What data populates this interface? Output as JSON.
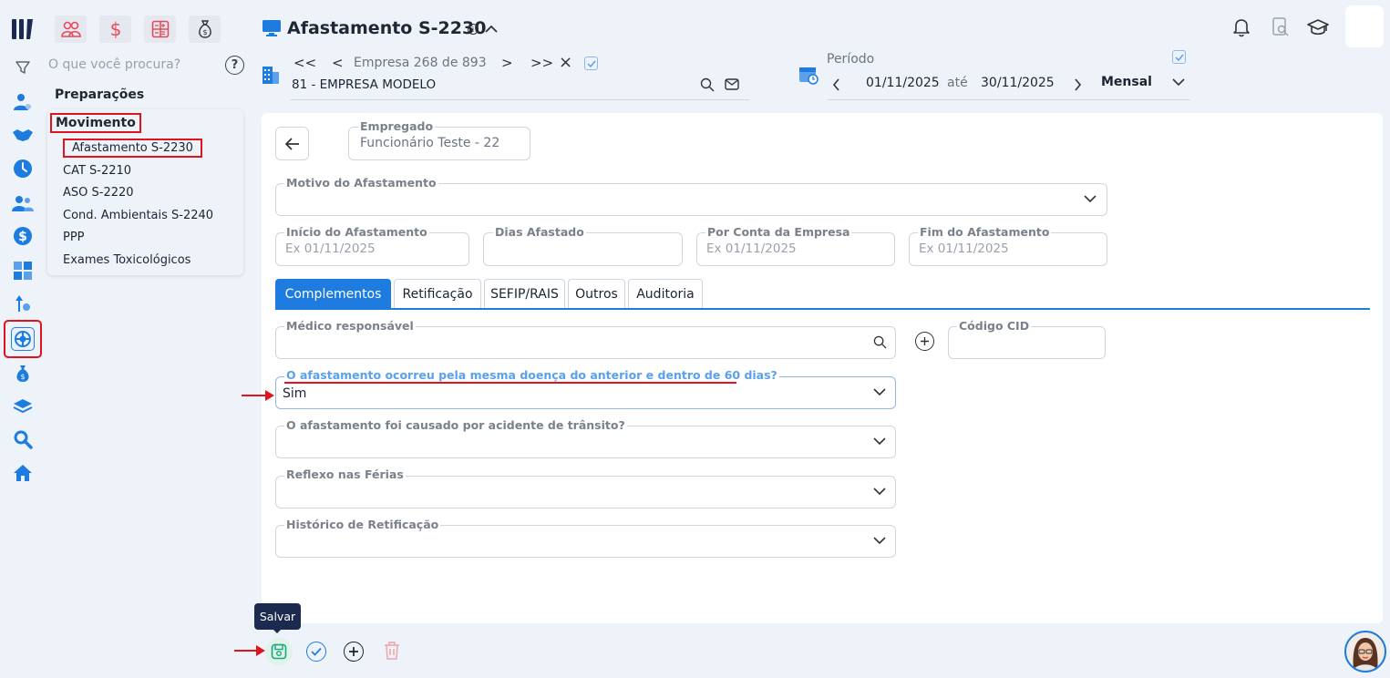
{
  "topbar": {
    "title": "Afastamento S-2230",
    "search_placeholder": "O que você procura?",
    "help": "?"
  },
  "empresa": {
    "nav_first": "<<",
    "nav_prev": "<",
    "counter": "Empresa 268 de 893",
    "nav_next": ">",
    "nav_last": ">>",
    "nav_close": "×",
    "name": "81 - EMPRESA MODELO"
  },
  "periodo": {
    "label": "Período",
    "start": "01/11/2025",
    "sep": "até",
    "end": "30/11/2025",
    "mode": "Mensal"
  },
  "sidebar": {
    "section": "Preparações",
    "group": "Movimento",
    "items": [
      {
        "label": "Afastamento S-2230"
      },
      {
        "label": "CAT S-2210"
      },
      {
        "label": "ASO S-2220"
      },
      {
        "label": "Cond. Ambientais S-2240"
      },
      {
        "label": "PPP"
      },
      {
        "label": "Exames Toxicológicos"
      }
    ]
  },
  "form": {
    "empregado_label": "Empregado",
    "empregado_value": "Funcionário Teste - 22",
    "motivo_label": "Motivo do Afastamento",
    "inicio_label": "Início do Afastamento",
    "inicio_placeholder": "Ex 01/11/2025",
    "dias_label": "Dias Afastado",
    "conta_label": "Por Conta da Empresa",
    "conta_placeholder": "Ex 01/11/2025",
    "fim_label": "Fim do Afastamento",
    "fim_placeholder": "Ex 01/11/2025",
    "tabs": [
      {
        "label": "Complementos"
      },
      {
        "label": "Retificação"
      },
      {
        "label": "SEFIP/RAIS"
      },
      {
        "label": "Outros"
      },
      {
        "label": "Auditoria"
      }
    ],
    "medico_label": "Médico responsável",
    "cid_label": "Código CID",
    "mesma_doenca_label": "O afastamento ocorreu pela mesma doença do anterior e dentro de 60 dias?",
    "mesma_doenca_value": "Sim",
    "transito_label": "O afastamento foi causado por acidente de trânsito?",
    "reflexo_label": "Reflexo nas Férias",
    "historico_label": "Histórico de Retificação"
  },
  "footer": {
    "tooltip": "Salvar"
  },
  "colors": {
    "accent": "#1e7be0",
    "annotation": "#e0141c",
    "save_green": "#1aa67a"
  }
}
